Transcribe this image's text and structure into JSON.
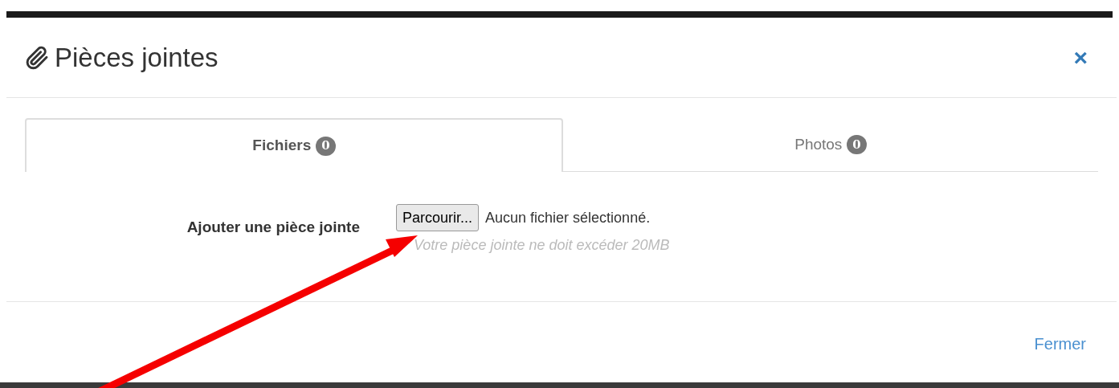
{
  "dialog": {
    "title": "Pièces jointes",
    "close": "×"
  },
  "tabs": [
    {
      "label": "Fichiers",
      "count": "0",
      "selected": true
    },
    {
      "label": "Photos",
      "count": "0",
      "selected": false
    }
  ],
  "form": {
    "label": "Ajouter une pièce jointe",
    "button": "Parcourir...",
    "file_status": "Aucun fichier sélectionné.",
    "hint": "Votre pièce jointe ne doit excéder 20MB"
  },
  "footer": {
    "button": "Fermer"
  }
}
